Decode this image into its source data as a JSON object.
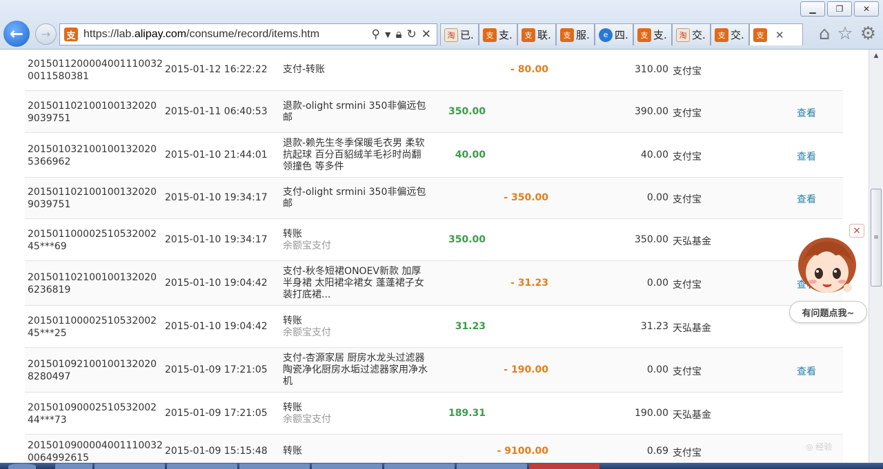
{
  "browser": {
    "url_prefix": "https://lab.",
    "url_domain": "alipay.com",
    "url_path": "/consume/record/items.htm",
    "tabs": [
      {
        "label": "已.",
        "icon": "doc"
      },
      {
        "label": "支.",
        "icon": "alipay"
      },
      {
        "label": "联.",
        "icon": "alipay"
      },
      {
        "label": "服.",
        "icon": "alipay"
      },
      {
        "label": "四.",
        "icon": "ie"
      },
      {
        "label": "支.",
        "icon": "alipay"
      },
      {
        "label": "交.",
        "icon": "doc"
      },
      {
        "label": "交.",
        "icon": "alipay"
      },
      {
        "label": "",
        "icon": "alipay",
        "active": true
      }
    ]
  },
  "records": [
    {
      "id": "2015011200004001110032\n0011580381",
      "time": "2015-01-12 16:22:22",
      "name": "支付-转账",
      "sub": "",
      "in": "",
      "out": "- 80.00",
      "balance": "310.00",
      "channel": "支付宝",
      "action": ""
    },
    {
      "id": "201501102100100132020\n9039751",
      "time": "2015-01-11 06:40:53",
      "name": "退款-olight srmini 350非偏远包邮",
      "sub": "",
      "in": "350.00",
      "out": "",
      "balance": "390.00",
      "channel": "支付宝",
      "action": "查看"
    },
    {
      "id": "201501032100100132020\n5366962",
      "time": "2015-01-10 21:44:01",
      "name": "退款-赖先生冬季保暖毛衣男 柔软抗起球 百分百貂绒羊毛衫时尚翻领撞色 等多件",
      "sub": "",
      "in": "40.00",
      "out": "",
      "balance": "40.00",
      "channel": "支付宝",
      "action": "查看"
    },
    {
      "id": "201501102100100132020\n9039751",
      "time": "2015-01-10 19:34:17",
      "name": "支付-olight srmini 350非偏远包邮",
      "sub": "",
      "in": "",
      "out": "- 350.00",
      "balance": "0.00",
      "channel": "支付宝",
      "action": "查看"
    },
    {
      "id": "201501100002510532002\n45***69",
      "time": "2015-01-10 19:34:17",
      "name": "转账",
      "sub": "余额宝支付",
      "in": "350.00",
      "out": "",
      "balance": "350.00",
      "channel": "天弘基金",
      "action": ""
    },
    {
      "id": "201501102100100132020\n6236819",
      "time": "2015-01-10 19:04:42",
      "name": "支付-秋冬短裙ONOEV新款 加厚半身裙 太阳裙伞裙女 蓬蓬裙子女装打底裙...",
      "sub": "",
      "in": "",
      "out": "- 31.23",
      "balance": "0.00",
      "channel": "支付宝",
      "action": "查看"
    },
    {
      "id": "201501100002510532002\n45***25",
      "time": "2015-01-10 19:04:42",
      "name": "转账",
      "sub": "余额宝支付",
      "in": "31.23",
      "out": "",
      "balance": "31.23",
      "channel": "天弘基金",
      "action": ""
    },
    {
      "id": "201501092100100132020\n8280497",
      "time": "2015-01-09 17:21:05",
      "name": "支付-杏源家居 厨房水龙头过滤器陶瓷净化厨房水垢过滤器家用净水机",
      "sub": "",
      "in": "",
      "out": "- 190.00",
      "balance": "0.00",
      "channel": "支付宝",
      "action": "查看"
    },
    {
      "id": "201501090002510532002\n44***73",
      "time": "2015-01-09 17:21:05",
      "name": "转账",
      "sub": "余额宝支付",
      "in": "189.31",
      "out": "",
      "balance": "190.00",
      "channel": "天弘基金",
      "action": ""
    },
    {
      "id": "2015010900004001110032\n0064992615",
      "time": "2015-01-09 15:15:48",
      "name": "转账",
      "sub": "",
      "in": "",
      "out": "- 9100.00",
      "balance": "0.69",
      "channel": "支付宝",
      "action": ""
    }
  ],
  "assistant": {
    "bubble": "有问题点我~",
    "close": "×"
  },
  "colors": {
    "income": "#3a9e4a",
    "expense": "#e57e16",
    "link": "#2a7fa8"
  }
}
